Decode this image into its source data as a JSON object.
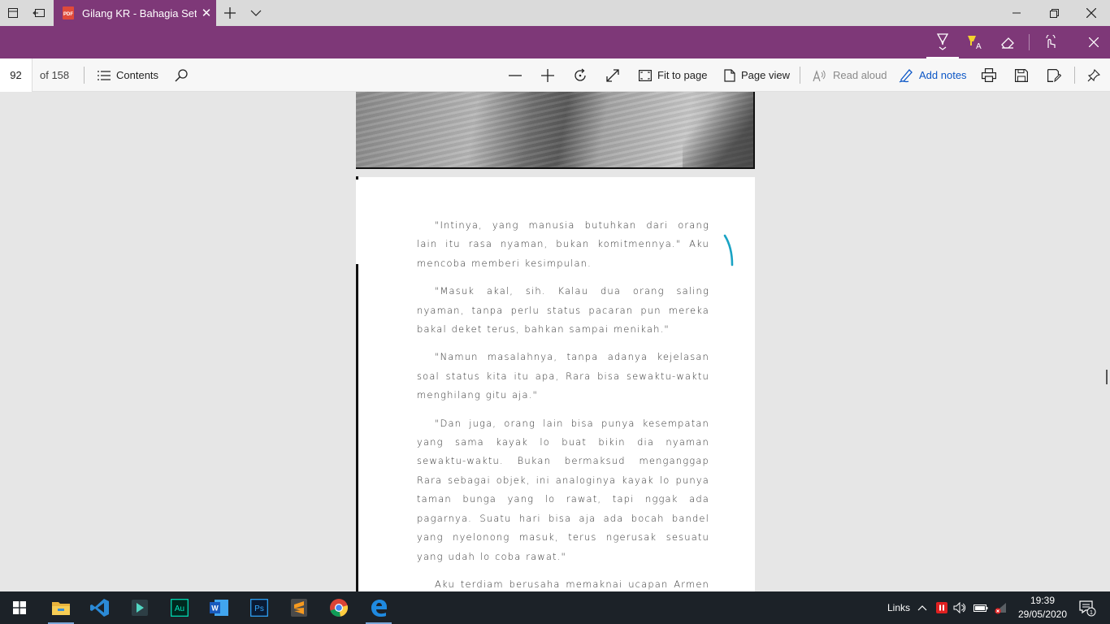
{
  "titlebar": {
    "tab_title": "Gilang KR - Bahagia Set",
    "pdf_badge": "PDF"
  },
  "toolbar": {
    "page_number": "92",
    "page_total": "of 158",
    "contents_label": "Contents",
    "fit_to_page_label": "Fit to page",
    "page_view_label": "Page view",
    "read_aloud_label": "Read aloud",
    "add_notes_label": "Add notes"
  },
  "document": {
    "paragraphs": [
      "\"Intinya, yang manusia butuhkan dari orang lain itu rasa nyaman, bukan komitmennya.\" Aku mencoba memberi kesimpulan.",
      "\"Masuk akal, sih. Kalau dua orang saling nyaman, tanpa perlu status pacaran pun mereka bakal deket terus, bahkan sampai menikah.\"",
      "\"Namun masalahnya, tanpa adanya kejelasan soal status kita itu apa, Rara bisa sewaktu-waktu menghilang gitu aja.\"",
      "\"Dan juga, orang lain bisa punya kesempatan yang sama kayak lo buat bikin dia nyaman sewaktu-waktu. Bukan bermaksud menganggap Rara sebagai objek, ini analoginya kayak lo punya taman bunga yang lo rawat, tapi nggak ada pagarnya. Suatu hari bisa aja ada bocah bandel yang nyelonong masuk, terus ngerusak sesuatu yang udah lo coba rawat.\"",
      "Aku terdiam berusaha memaknai ucapan Armen baru saja. Tanpa adanya kejelasan soal aku siapa,"
    ]
  },
  "taskbar": {
    "links_label": "Links",
    "time": "19:39",
    "date": "29/05/2020",
    "notification_count": "1",
    "apps": [
      "file-explorer",
      "vscode",
      "filmora",
      "audition",
      "word",
      "photoshop",
      "sublime-text",
      "chrome",
      "edge"
    ]
  },
  "colors": {
    "accent_purple": "#7e3878",
    "taskbar": "#1c2228",
    "ink_teal": "#1aa3c4",
    "link_blue": "#0b56c6"
  }
}
